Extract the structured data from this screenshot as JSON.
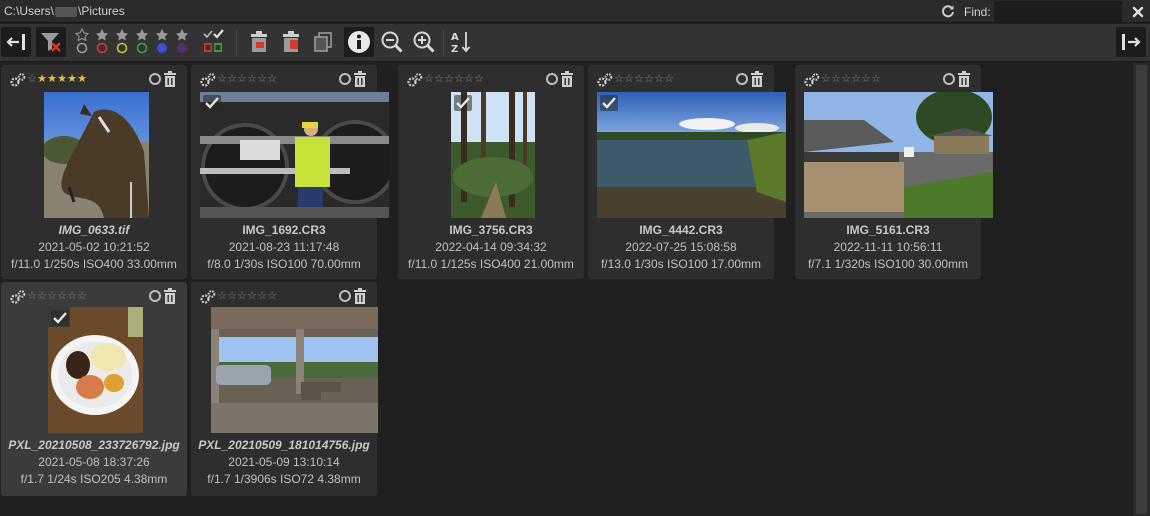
{
  "window": {
    "path_prefix": "C:\\Users\\",
    "path_suffix": "\\Pictures",
    "find_label": "Find:",
    "find_value": "",
    "icons": {
      "refresh": "refresh-icon",
      "close": "close-icon"
    }
  },
  "toolbar": {
    "icons": [
      "collapse-left-panel-icon",
      "filter-clear-icon",
      "star-filter-icons",
      "color-label-filter-icons",
      "tagged-filter-icons",
      "delete-icon",
      "delete-raw-icon",
      "copy-icon",
      "info-icon",
      "zoom-out-icon",
      "zoom-in-icon",
      "sort-az-icon",
      "collapse-right-panel-icon"
    ],
    "star_filter_count": 5,
    "color_labels": [
      "#9a9a9a",
      "#d43b2c",
      "#c9c92f",
      "#3ca03c",
      "#3c4fd4",
      "#8a3c9a"
    ]
  },
  "thumbnails": [
    {
      "file": "IMG_0633.tif",
      "date": "2021-05-02 10:21:52",
      "exif": "f/11.0 1/250s ISO400 33.00mm",
      "rating": 5,
      "italic": true,
      "selected": false,
      "tagged": false
    },
    {
      "file": "IMG_1692.CR3",
      "date": "2021-08-23 11:17:48",
      "exif": "f/8.0 1/30s ISO100 70.00mm",
      "rating": 0,
      "italic": false,
      "selected": false,
      "tagged": true
    },
    {
      "file": "IMG_3756.CR3",
      "date": "2022-04-14 09:34:32",
      "exif": "f/11.0 1/125s ISO400 21.00mm",
      "rating": 0,
      "italic": false,
      "selected": false,
      "tagged": true
    },
    {
      "file": "IMG_4442.CR3",
      "date": "2022-07-25 15:08:58",
      "exif": "f/13.0 1/30s ISO100 17.00mm",
      "rating": 0,
      "italic": false,
      "selected": false,
      "tagged": true
    },
    {
      "file": "IMG_5161.CR3",
      "date": "2022-11-11 10:56:11",
      "exif": "f/7.1 1/320s ISO100 30.00mm",
      "rating": 0,
      "italic": false,
      "selected": false,
      "tagged": false
    },
    {
      "file": "PXL_20210508_233726792.jpg",
      "date": "2021-05-08 18:37:26",
      "exif": "f/1.7 1/24s ISO205 4.38mm",
      "rating": 0,
      "italic": true,
      "selected": true,
      "tagged": true
    },
    {
      "file": "PXL_20210509_181014756.jpg",
      "date": "2021-05-09 13:10:14",
      "exif": "f/1.7 1/3906s ISO72 4.38mm",
      "rating": 0,
      "italic": true,
      "selected": false,
      "tagged": false
    }
  ]
}
